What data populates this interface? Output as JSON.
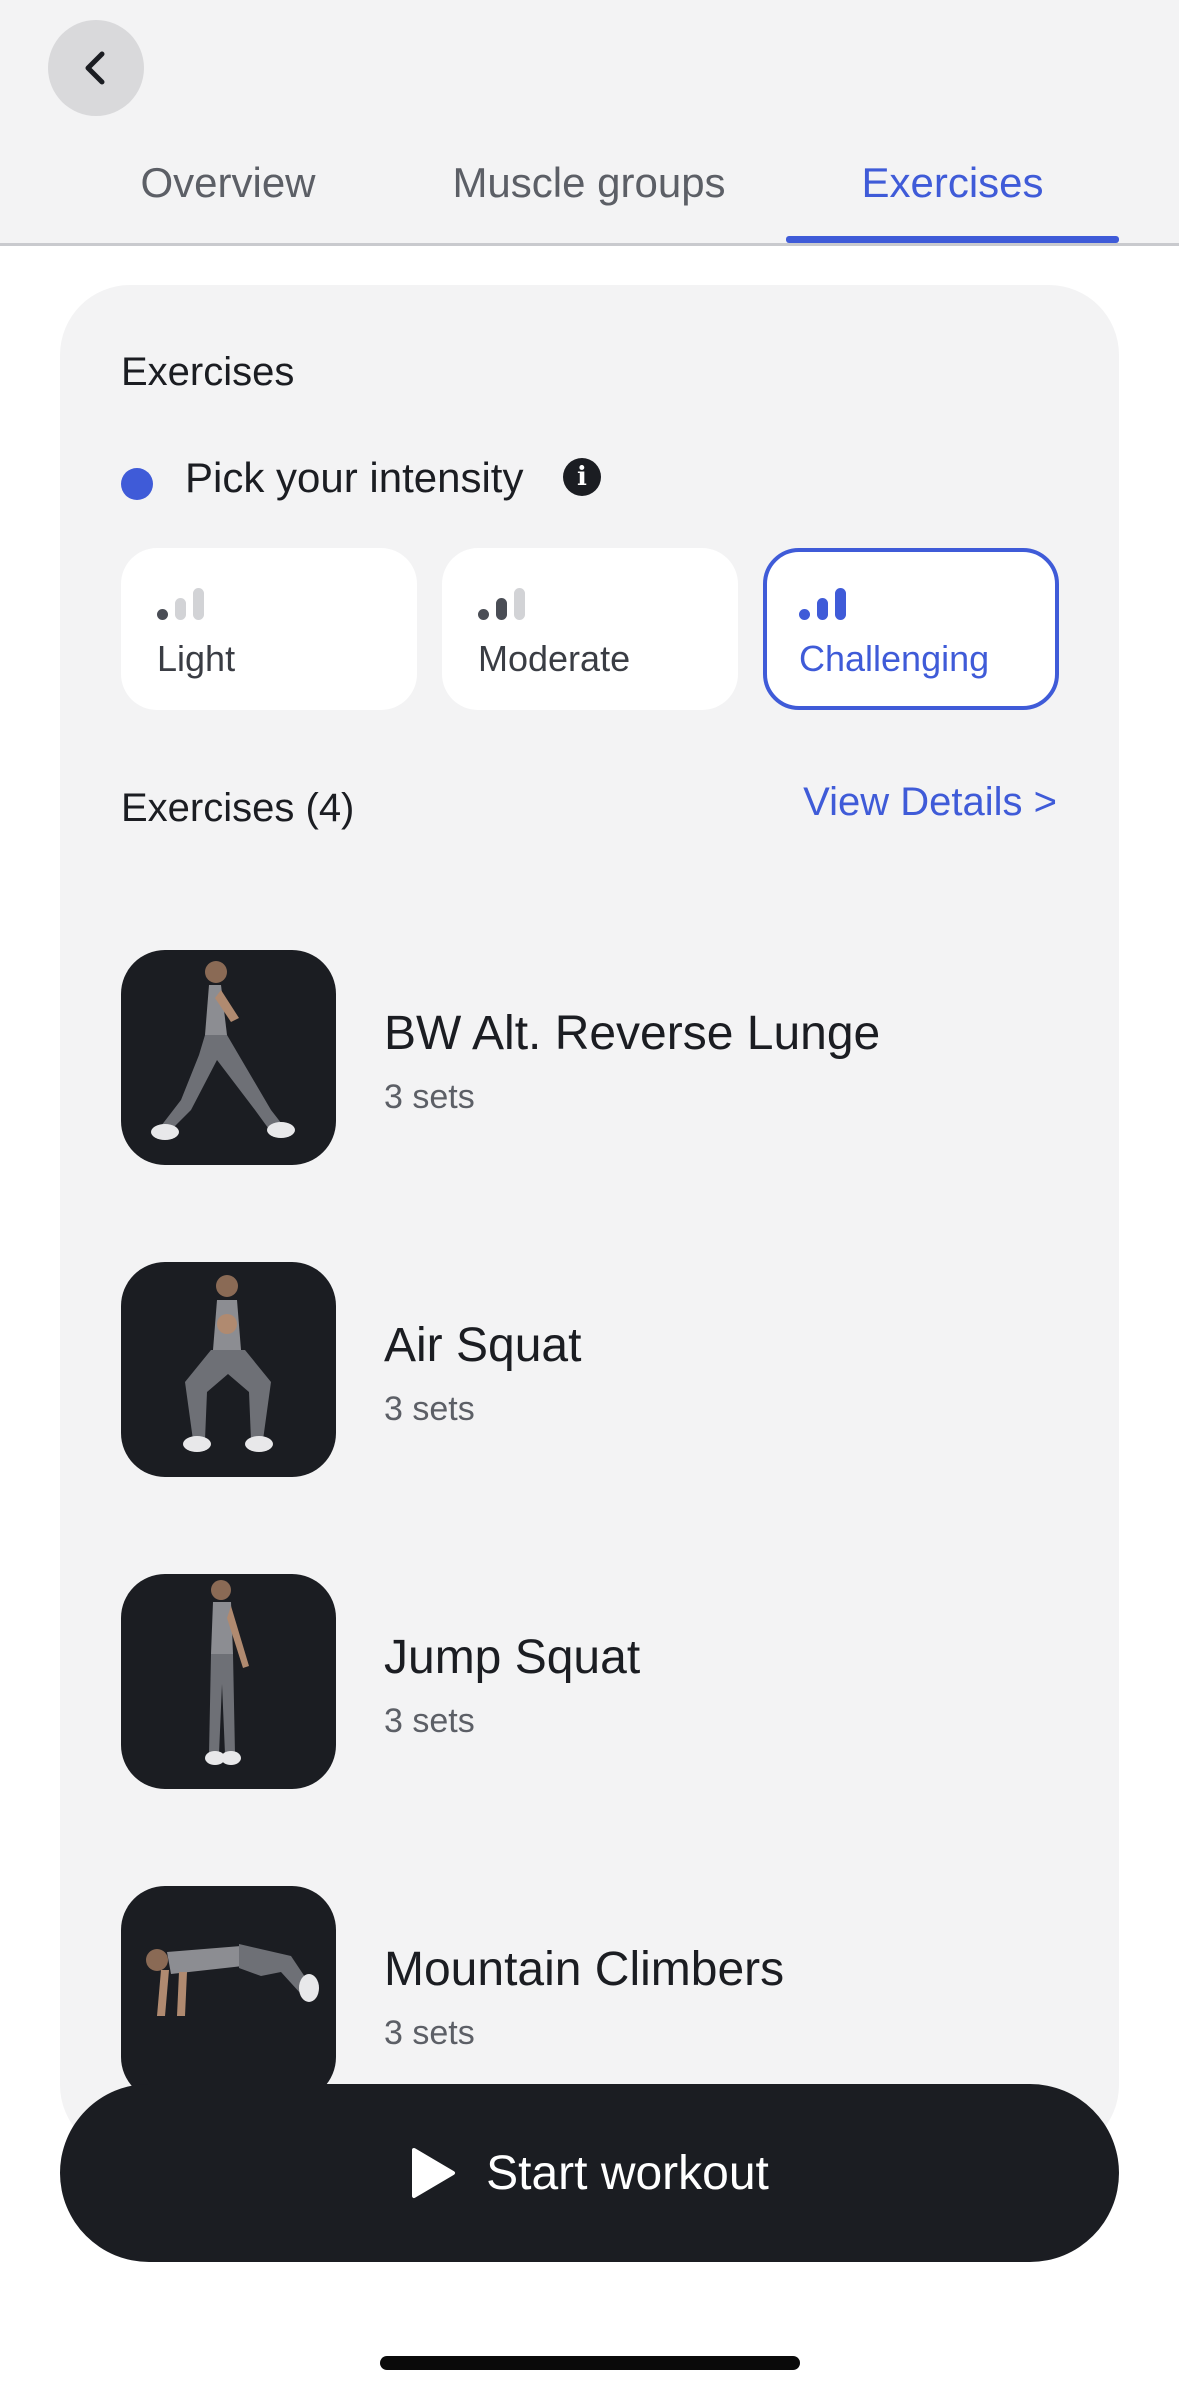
{
  "header": {
    "back_icon": "chevron-left-icon",
    "tabs": [
      {
        "label": "Overview",
        "active": false
      },
      {
        "label": "Muscle groups",
        "active": false
      },
      {
        "label": "Exercises",
        "active": true
      }
    ]
  },
  "card": {
    "title": "Exercises",
    "intensity_label": "Pick your intensity",
    "info_icon": "info-icon",
    "intensity_options": [
      {
        "label": "Light",
        "level": 1,
        "selected": false
      },
      {
        "label": "Moderate",
        "level": 2,
        "selected": false
      },
      {
        "label": "Challenging",
        "level": 3,
        "selected": true
      }
    ],
    "exercise_count_label": "Exercises (4)",
    "view_details": "View Details >",
    "exercises": [
      {
        "name": "BW Alt. Reverse Lunge",
        "sets": "3 sets"
      },
      {
        "name": "Air Squat",
        "sets": "3 sets"
      },
      {
        "name": "Jump Squat",
        "sets": "3 sets"
      },
      {
        "name": "Mountain Climbers",
        "sets": "3 sets"
      }
    ]
  },
  "footer": {
    "start_label": "Start workout",
    "play_icon": "play-icon"
  },
  "colors": {
    "accent": "#3f5bd8",
    "dark": "#1b1d22",
    "card_bg": "#f3f3f4"
  }
}
